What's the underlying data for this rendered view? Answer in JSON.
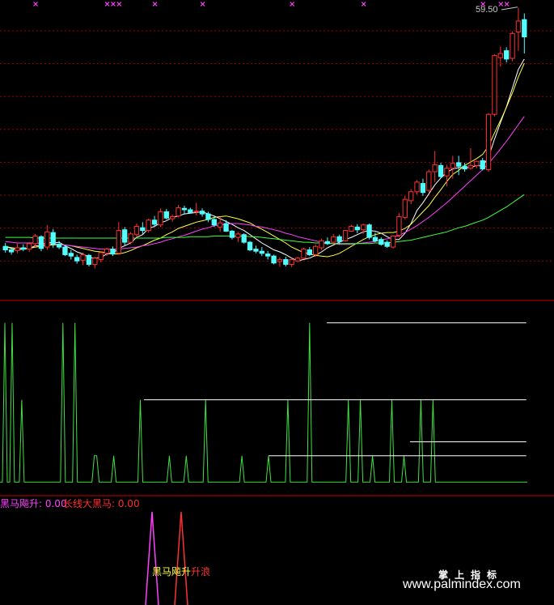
{
  "price_label": "59.50",
  "indicator": {
    "name_1": "黑马飚升: 0.00",
    "name_2": "长线大黑马: 0.00",
    "overlay_1": "黑马飚升",
    "overlay_2": "升浪"
  },
  "watermark": {
    "cn": "掌上指标",
    "url": "www.palmindex.com"
  },
  "colors": {
    "up": "#ff3030",
    "down": "#50ffff",
    "ma5": "#ffffff",
    "ma10": "#ffff40",
    "ma20": "#ff40ff",
    "ma60": "#40ff40",
    "grid": "#a00000",
    "osc": "#40e040",
    "magenta": "#ff40ff",
    "red": "#ff3030"
  },
  "chart_data": [
    {
      "type": "candlestick",
      "ylim": [
        20,
        61
      ],
      "grid": true,
      "annotation": "59.50",
      "candles": [
        [
          26.3,
          26.8,
          25.4,
          25.8
        ],
        [
          25.8,
          26.2,
          25.1,
          25.5
        ],
        [
          25.7,
          26.7,
          25.3,
          26.1
        ],
        [
          26.1,
          26.6,
          25.6,
          25.9
        ],
        [
          25.9,
          26.9,
          25.5,
          26.7
        ],
        [
          26.7,
          28.1,
          26.2,
          27.8
        ],
        [
          27.7,
          27.9,
          25.6,
          26.0
        ],
        [
          26.2,
          29.4,
          25.8,
          28.4
        ],
        [
          28.3,
          28.8,
          26.1,
          26.6
        ],
        [
          26.6,
          27.1,
          25.9,
          26.2
        ],
        [
          26.2,
          26.5,
          24.9,
          25.1
        ],
        [
          25.3,
          25.8,
          24.4,
          24.9
        ],
        [
          24.7,
          25.1,
          23.8,
          24.2
        ],
        [
          24.3,
          25.4,
          23.6,
          25.1
        ],
        [
          25.0,
          25.2,
          23.4,
          23.7
        ],
        [
          23.7,
          24.8,
          23.1,
          24.6
        ],
        [
          24.4,
          25.6,
          24.0,
          25.4
        ],
        [
          25.3,
          26.1,
          24.9,
          25.9
        ],
        [
          25.9,
          26.3,
          24.9,
          25.2
        ],
        [
          25.3,
          29.8,
          25.1,
          28.6
        ],
        [
          28.7,
          29.1,
          26.4,
          26.9
        ],
        [
          26.9,
          28.4,
          26.6,
          28.1
        ],
        [
          28.0,
          29.6,
          27.6,
          29.2
        ],
        [
          29.0,
          29.8,
          28.1,
          28.6
        ],
        [
          28.6,
          30.3,
          28.3,
          30.1
        ],
        [
          30.1,
          30.7,
          29.1,
          29.5
        ],
        [
          29.4,
          31.8,
          29.1,
          31.3
        ],
        [
          31.3,
          31.7,
          30.2,
          30.4
        ],
        [
          30.3,
          30.9,
          29.9,
          30.6
        ],
        [
          30.7,
          32.3,
          30.5,
          31.9
        ],
        [
          31.8,
          32.2,
          30.9,
          31.6
        ],
        [
          31.6,
          31.9,
          31.1,
          31.2
        ],
        [
          31.3,
          32.6,
          30.8,
          31.4
        ],
        [
          31.4,
          31.8,
          30.6,
          31.0
        ],
        [
          31.0,
          31.3,
          29.8,
          30.2
        ],
        [
          30.2,
          30.6,
          29.1,
          29.4
        ],
        [
          29.1,
          30.6,
          28.4,
          29.7
        ],
        [
          29.6,
          30.1,
          28.4,
          28.5
        ],
        [
          28.5,
          28.7,
          27.3,
          27.6
        ],
        [
          27.6,
          28.4,
          26.9,
          28.1
        ],
        [
          28.0,
          28.2,
          26.7,
          26.9
        ],
        [
          26.9,
          27.1,
          25.6,
          25.8
        ],
        [
          25.9,
          26.4,
          25.3,
          25.6
        ],
        [
          25.6,
          26.2,
          24.9,
          25.3
        ],
        [
          25.2,
          25.6,
          24.4,
          24.9
        ],
        [
          24.9,
          25.1,
          23.7,
          23.9
        ],
        [
          24.1,
          24.7,
          23.4,
          24.4
        ],
        [
          24.4,
          24.8,
          23.4,
          23.7
        ],
        [
          23.7,
          24.6,
          23.3,
          24.4
        ],
        [
          24.2,
          24.8,
          24.0,
          24.6
        ],
        [
          24.6,
          26.1,
          24.5,
          25.9
        ],
        [
          25.8,
          26.2,
          24.9,
          25.1
        ],
        [
          25.1,
          26.6,
          24.8,
          26.3
        ],
        [
          26.1,
          27.4,
          25.8,
          27.1
        ],
        [
          27.0,
          27.6,
          26.5,
          26.7
        ],
        [
          26.9,
          28.1,
          26.6,
          27.7
        ],
        [
          27.7,
          28.0,
          26.6,
          27.0
        ],
        [
          27.1,
          28.7,
          27.0,
          28.6
        ],
        [
          28.5,
          29.4,
          28.4,
          29.2
        ],
        [
          29.1,
          29.5,
          28.2,
          28.7
        ],
        [
          28.7,
          29.6,
          28.1,
          29.4
        ],
        [
          29.4,
          29.6,
          27.3,
          27.6
        ],
        [
          27.6,
          28.3,
          26.9,
          27.1
        ],
        [
          27.3,
          27.6,
          26.4,
          26.6
        ],
        [
          26.9,
          27.2,
          26.1,
          26.3
        ],
        [
          26.2,
          27.9,
          26.0,
          27.8
        ],
        [
          27.9,
          31.1,
          27.6,
          30.6
        ],
        [
          30.5,
          33.6,
          30.2,
          33.1
        ],
        [
          32.9,
          34.6,
          32.4,
          34.2
        ],
        [
          34.2,
          35.9,
          33.8,
          35.6
        ],
        [
          35.4,
          36.1,
          33.6,
          34.1
        ],
        [
          34.4,
          37.4,
          34.1,
          37.1
        ],
        [
          37.1,
          40.1,
          35.6,
          38.1
        ],
        [
          38.0,
          38.4,
          36.2,
          36.4
        ],
        [
          36.5,
          38.1,
          35.0,
          37.6
        ],
        [
          37.6,
          39.4,
          36.1,
          38.3
        ],
        [
          38.4,
          39.4,
          36.6,
          37.9
        ],
        [
          37.9,
          38.4,
          37.1,
          37.5
        ],
        [
          37.6,
          40.5,
          37.4,
          38.0
        ],
        [
          38.0,
          38.7,
          37.6,
          38.6
        ],
        [
          38.7,
          39.1,
          37.3,
          37.5
        ],
        [
          37.4,
          45.6,
          37.1,
          45.4
        ],
        [
          45.4,
          54.1,
          45.1,
          53.9
        ],
        [
          53.6,
          55.2,
          52.3,
          54.2
        ],
        [
          54.6,
          55.1,
          52.9,
          53.4
        ],
        [
          53.5,
          57.4,
          53.1,
          57.1
        ],
        [
          57.3,
          60.8,
          54.6,
          58.9
        ],
        [
          59.1,
          60.0,
          54.2,
          56.6
        ]
      ],
      "ma": [
        {
          "name": "MA5",
          "values": [
            26.3,
            26.0,
            25.8,
            25.9,
            26.0,
            26.4,
            26.4,
            26.9,
            26.8,
            26.9,
            26.4,
            26.0,
            25.5,
            25.2,
            24.7,
            24.6,
            24.7,
            25.2,
            25.3,
            26.0,
            26.4,
            26.8,
            27.6,
            28.0,
            28.9,
            29.2,
            29.7,
            30.0,
            30.5,
            30.7,
            31.0,
            31.1,
            31.2,
            31.3,
            31.0,
            30.7,
            30.3,
            29.9,
            29.5,
            29.0,
            28.6,
            28.0,
            27.4,
            26.8,
            26.3,
            25.8,
            25.5,
            25.1,
            24.6,
            24.2,
            24.4,
            24.6,
            25.0,
            25.5,
            26.1,
            26.5,
            26.9,
            27.3,
            27.6,
            28.0,
            28.4,
            28.6,
            28.5,
            28.2,
            27.7,
            27.3,
            27.3,
            28.2,
            29.6,
            31.5,
            32.6,
            33.9,
            35.2,
            36.2,
            37.0,
            37.5,
            37.7,
            37.7,
            37.7,
            38.0,
            37.9,
            39.2,
            41.8,
            44.2,
            46.5,
            49.2,
            51.9,
            53.4
          ]
        },
        {
          "name": "MA10",
          "values": [
            26.3,
            26.1,
            26.0,
            26.0,
            26.0,
            26.2,
            26.3,
            26.5,
            26.5,
            26.6,
            26.5,
            26.4,
            26.2,
            26.0,
            25.8,
            25.6,
            25.5,
            25.4,
            25.2,
            25.2,
            25.4,
            25.7,
            26.1,
            26.4,
            26.8,
            27.2,
            27.5,
            28.0,
            28.4,
            28.9,
            29.2,
            29.5,
            29.8,
            30.0,
            30.2,
            30.5,
            30.6,
            30.7,
            30.5,
            30.3,
            30.0,
            29.7,
            29.2,
            28.8,
            28.3,
            27.8,
            27.3,
            26.8,
            26.2,
            25.8,
            25.4,
            25.2,
            25.0,
            24.9,
            24.8,
            25.0,
            25.3,
            25.8,
            26.3,
            26.8,
            27.3,
            27.7,
            28.0,
            28.2,
            28.3,
            28.3,
            28.5,
            28.9,
            29.5,
            30.4,
            31.3,
            32.2,
            33.4,
            34.5,
            35.7,
            36.7,
            37.3,
            38.0,
            38.5,
            39.0,
            39.6,
            40.8,
            42.7,
            44.5,
            46.4,
            48.5,
            50.8,
            52.8
          ]
        },
        {
          "name": "MA20",
          "values": [
            27.0,
            26.9,
            26.8,
            26.8,
            26.8,
            26.8,
            26.7,
            26.7,
            26.7,
            26.6,
            26.5,
            26.4,
            26.3,
            26.2,
            26.1,
            26.0,
            25.9,
            25.9,
            25.9,
            25.9,
            26.0,
            26.1,
            26.2,
            26.4,
            26.5,
            26.7,
            26.9,
            27.2,
            27.4,
            27.7,
            27.9,
            28.2,
            28.5,
            28.8,
            29.0,
            29.3,
            29.4,
            29.5,
            29.6,
            29.6,
            29.5,
            29.4,
            29.2,
            29.1,
            28.9,
            28.7,
            28.5,
            28.2,
            28.0,
            27.7,
            27.5,
            27.3,
            27.1,
            26.9,
            26.8,
            26.7,
            26.6,
            26.6,
            26.6,
            26.7,
            26.8,
            26.9,
            27.0,
            27.2,
            27.4,
            27.6,
            27.9,
            28.3,
            28.8,
            29.3,
            29.9,
            30.5,
            31.2,
            31.9,
            32.6,
            33.4,
            34.2,
            35.0,
            35.8,
            36.6,
            37.4,
            38.3,
            39.3,
            40.4,
            41.5,
            42.7,
            43.9,
            45.1
          ]
        },
        {
          "name": "MA60",
          "values": [
            27.6,
            27.6,
            27.6,
            27.6,
            27.6,
            27.5,
            27.5,
            27.5,
            27.5,
            27.5,
            27.5,
            27.5,
            27.5,
            27.5,
            27.5,
            27.5,
            27.5,
            27.5,
            27.5,
            27.5,
            27.5,
            27.5,
            27.5,
            27.5,
            27.5,
            27.5,
            27.5,
            27.6,
            27.6,
            27.6,
            27.6,
            27.7,
            27.7,
            27.7,
            27.7,
            27.8,
            27.8,
            27.8,
            27.8,
            27.8,
            27.8,
            27.7,
            27.7,
            27.6,
            27.5,
            27.4,
            27.3,
            27.2,
            27.1,
            27.0,
            26.9,
            26.9,
            26.8,
            26.8,
            26.7,
            26.7,
            26.7,
            26.7,
            26.7,
            26.7,
            26.7,
            26.7,
            26.8,
            26.8,
            26.8,
            26.9,
            27.0,
            27.1,
            27.2,
            27.4,
            27.6,
            27.8,
            28.0,
            28.2,
            28.4,
            28.7,
            29.0,
            29.2,
            29.5,
            29.8,
            30.1,
            30.5,
            31.0,
            31.5,
            32.0,
            32.6,
            33.2,
            33.8
          ]
        }
      ],
      "markers_top": [
        5,
        17,
        18,
        19,
        25,
        33,
        48,
        60,
        80,
        83,
        84
      ]
    },
    {
      "type": "line",
      "ylim": [
        0,
        100
      ],
      "grid": false,
      "series": [
        {
          "values": [
            5,
            5,
            96,
            5,
            5,
            96,
            5,
            5,
            5,
            52,
            5,
            5,
            5,
            5,
            5,
            5,
            5,
            5,
            5,
            5,
            5,
            5,
            5,
            5,
            5,
            5,
            96,
            5,
            5,
            5,
            5,
            96,
            5,
            5,
            5,
            5,
            5,
            5,
            5,
            20,
            20,
            5,
            5,
            5,
            5,
            5,
            5,
            20,
            5,
            5,
            5,
            5,
            5,
            5,
            5,
            5,
            5,
            5,
            52,
            5,
            5,
            5,
            5,
            5,
            5,
            5,
            5,
            5,
            5,
            5,
            20,
            5,
            5,
            5,
            5,
            5,
            5,
            20,
            5,
            5,
            5,
            5,
            5,
            5,
            5,
            52,
            5,
            5,
            5,
            5,
            5,
            5,
            5,
            5,
            5,
            5,
            5,
            5,
            5,
            5,
            20,
            5,
            5,
            5,
            5,
            5,
            5,
            5,
            5,
            5,
            5,
            20,
            5,
            5,
            5,
            5,
            5,
            5,
            5,
            52,
            5,
            5,
            5,
            5,
            5,
            5,
            5,
            5,
            96,
            5,
            5,
            5,
            5,
            5,
            5,
            5,
            5,
            5,
            5,
            5,
            5,
            5,
            5,
            5,
            52,
            5,
            5,
            5,
            5,
            52,
            5,
            5,
            5,
            5,
            20,
            5,
            5,
            5,
            5,
            5,
            5,
            5,
            52,
            5,
            5,
            5,
            5,
            20,
            5,
            5,
            5,
            5,
            5,
            5,
            52,
            5,
            5,
            5,
            5,
            52,
            5,
            5,
            5,
            5,
            5,
            5,
            5,
            5,
            5,
            5,
            5,
            5,
            5,
            5,
            5,
            5,
            5,
            5,
            5,
            5,
            5,
            5,
            5,
            5,
            5,
            5,
            5,
            5,
            5,
            5,
            5,
            5,
            5,
            5,
            5,
            5,
            5,
            5,
            5
          ]
        }
      ],
      "hlines": [
        {
          "y": 96,
          "x_from": 0.59,
          "x_to": 0.95
        },
        {
          "y": 52,
          "x_from": 0.26,
          "x_to": 0.95
        },
        {
          "y": 20,
          "x_from": 0.485,
          "x_to": 0.95
        },
        {
          "y": 28,
          "x_from": 0.74,
          "x_to": 0.95
        }
      ]
    },
    {
      "type": "line",
      "ylim": [
        0,
        100
      ],
      "series": [
        {
          "values": [
            0,
            100,
            0
          ]
        },
        {
          "values": [
            0,
            100,
            0
          ]
        }
      ]
    }
  ]
}
